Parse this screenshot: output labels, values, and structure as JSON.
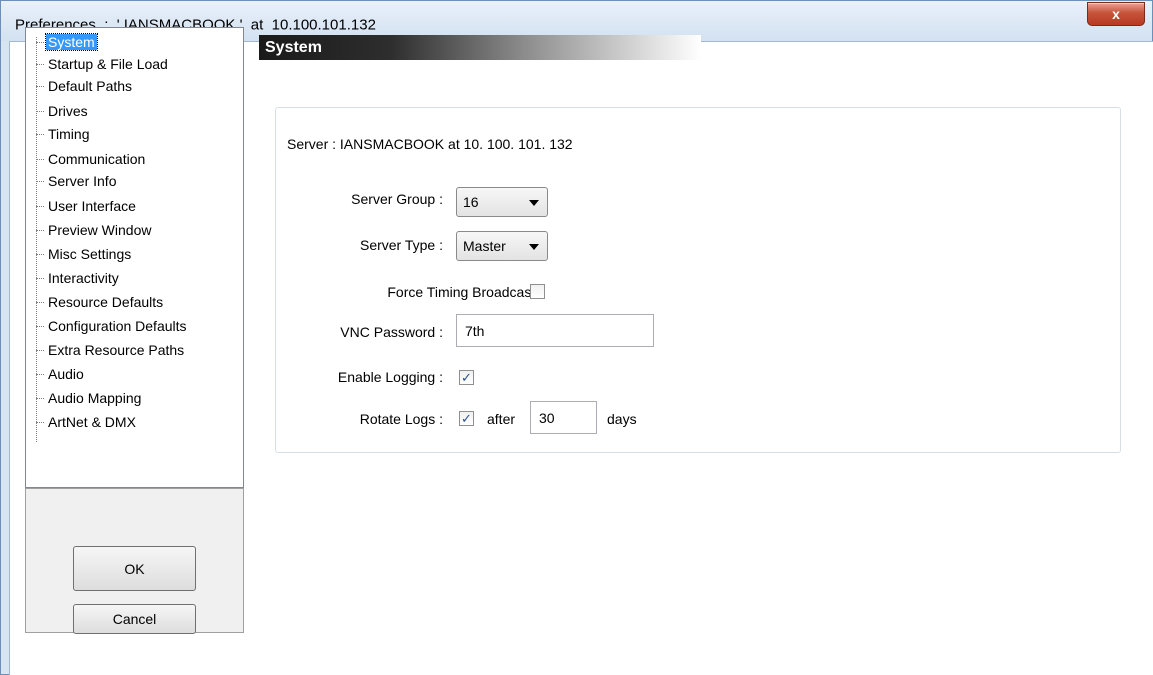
{
  "window": {
    "title": "Preferences  :  ' IANSMACBOOK '  at  10.100.101.132",
    "close_label": "x"
  },
  "tree": {
    "items": [
      {
        "label": "System",
        "selected": true
      },
      {
        "label": "Startup & File Load"
      },
      {
        "label": "Default Paths"
      },
      {
        "label": "Drives"
      },
      {
        "label": "Timing"
      },
      {
        "label": "Communication"
      },
      {
        "label": "Server Info"
      },
      {
        "label": "User Interface"
      },
      {
        "label": "Preview Window"
      },
      {
        "label": "Misc Settings"
      },
      {
        "label": "Interactivity"
      },
      {
        "label": "Resource Defaults"
      },
      {
        "label": "Configuration Defaults"
      },
      {
        "label": "Extra Resource Paths"
      },
      {
        "label": "Audio"
      },
      {
        "label": "Audio Mapping"
      },
      {
        "label": "ArtNet & DMX"
      }
    ]
  },
  "buttons": {
    "ok_label": "OK",
    "cancel_label": "Cancel"
  },
  "system": {
    "header": "System",
    "group_title": "Server : IANSMACBOOK  at  10. 100. 101. 132",
    "server_group_label": "Server Group :",
    "server_group_value": "16",
    "server_type_label": "Server Type :",
    "server_type_value": "Master",
    "force_timing_label": "Force Timing Broadcast :",
    "force_timing_checked": false,
    "vnc_password_label": "VNC Password :",
    "vnc_password_value": "7th",
    "enable_logging_label": "Enable Logging :",
    "enable_logging_checked": true,
    "rotate_logs_label": "Rotate Logs :",
    "rotate_logs_checked": true,
    "after_label": "after",
    "rotate_days_value": "30",
    "days_label": "days",
    "check_glyph": "✓"
  }
}
